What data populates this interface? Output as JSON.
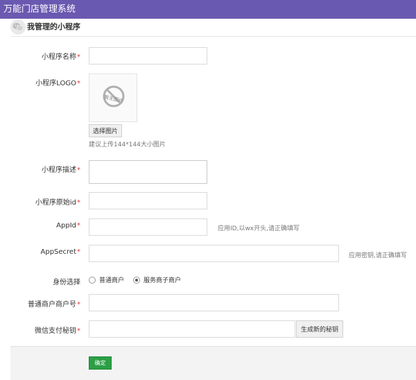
{
  "app": {
    "title": "万能门店管理系统"
  },
  "panel": {
    "title": "我管理的小程序",
    "icon": "wechat-icon"
  },
  "form": {
    "required_mark": "*",
    "name": {
      "label": "小程序名称",
      "value": ""
    },
    "logo": {
      "label": "小程序LOGO",
      "placeholder_text": "暂无图片",
      "select_button": "选择图片",
      "hint": "建议上传144*144大小图片"
    },
    "description": {
      "label": "小程序描述",
      "value": ""
    },
    "original_id": {
      "label": "小程序原始id",
      "value": ""
    },
    "appid": {
      "label": "AppId",
      "value": "",
      "hint": "应用ID,以wx开头,请正确填写"
    },
    "appsecret": {
      "label": "AppSecret",
      "value": "",
      "hint": "应用密钥,请正确填写"
    },
    "identity": {
      "label": "身份选择",
      "options": [
        {
          "label": "普通商户",
          "checked": false
        },
        {
          "label": "服务商子商户",
          "checked": true
        }
      ]
    },
    "merchant_id": {
      "label": "普通商户商户号",
      "value": ""
    },
    "pay_secret": {
      "label": "微信支付秘钥",
      "value": "",
      "generate_button": "生成新的秘钥"
    }
  },
  "footer": {
    "confirm_label": "确定"
  }
}
